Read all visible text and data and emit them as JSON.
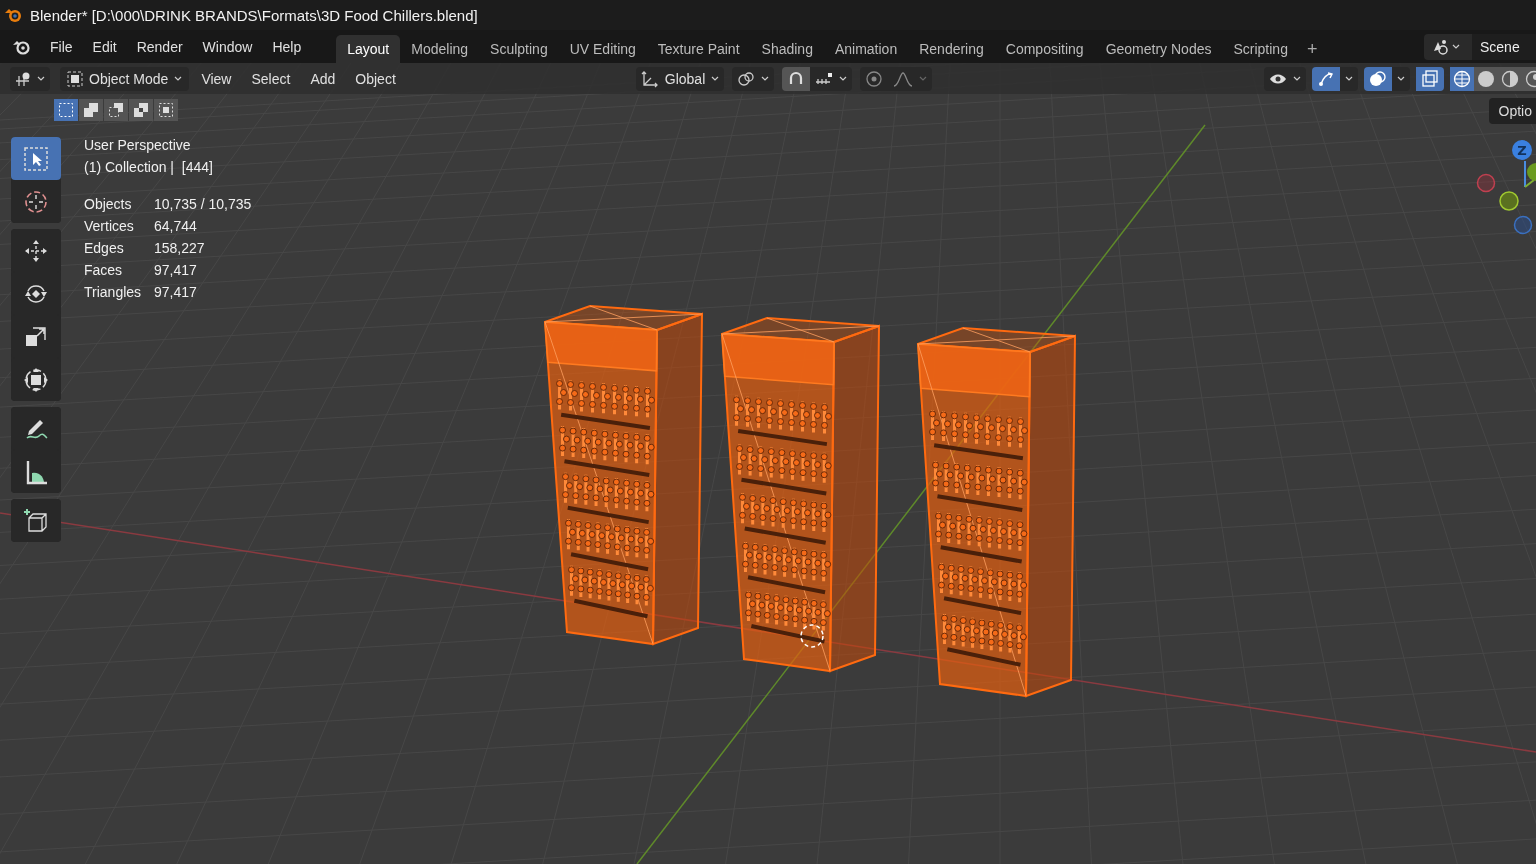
{
  "window": {
    "title": "Blender* [D:\\000\\DRINK BRANDS\\Formats\\3D Food Chillers.blend]"
  },
  "menu": [
    "File",
    "Edit",
    "Render",
    "Window",
    "Help"
  ],
  "workspaces": [
    {
      "label": "Layout",
      "selected": true
    },
    {
      "label": "Modeling",
      "selected": false
    },
    {
      "label": "Sculpting",
      "selected": false
    },
    {
      "label": "UV Editing",
      "selected": false
    },
    {
      "label": "Texture Paint",
      "selected": false
    },
    {
      "label": "Shading",
      "selected": false
    },
    {
      "label": "Animation",
      "selected": false
    },
    {
      "label": "Rendering",
      "selected": false
    },
    {
      "label": "Compositing",
      "selected": false
    },
    {
      "label": "Geometry Nodes",
      "selected": false
    },
    {
      "label": "Scripting",
      "selected": false
    }
  ],
  "add_workspace": "+",
  "scene": "Scene",
  "header": {
    "mode": "Object Mode",
    "menus": [
      "View",
      "Select",
      "Add",
      "Object"
    ],
    "orientation": "Global",
    "options": "Optio"
  },
  "select_modes": [
    {
      "kind": "set",
      "selected": true
    },
    {
      "kind": "extend",
      "selected": false
    },
    {
      "kind": "subtract",
      "selected": false
    },
    {
      "kind": "difference",
      "selected": false
    },
    {
      "kind": "intersect",
      "selected": false
    }
  ],
  "toggles": [
    {
      "kind": "gizmo",
      "on": true
    },
    {
      "kind": "overlay",
      "on": true
    },
    {
      "kind": "xray",
      "on": true
    }
  ],
  "shading": [
    {
      "kind": "wireframe",
      "selected": true
    },
    {
      "kind": "solid",
      "selected": false
    },
    {
      "kind": "material",
      "selected": false
    },
    {
      "kind": "rendered",
      "selected": false
    }
  ],
  "tools": [
    {
      "kind": "select-box",
      "selected": true
    },
    {
      "kind": "cursor",
      "selected": false
    },
    {
      "kind": "move",
      "selected": false
    },
    {
      "kind": "rotate",
      "selected": false
    },
    {
      "kind": "scale",
      "selected": false
    },
    {
      "kind": "transform",
      "selected": false
    },
    {
      "kind": "annotate",
      "selected": false
    },
    {
      "kind": "measure",
      "selected": false
    },
    {
      "kind": "add-cube",
      "selected": false
    }
  ],
  "overlay_info": {
    "view": "User Perspective",
    "collection": "(1) Collection |  [444]",
    "stats": [
      {
        "label": "Objects",
        "value": "10,735 / 10,735"
      },
      {
        "label": "Vertices",
        "value": "64,744"
      },
      {
        "label": "Edges",
        "value": "158,227"
      },
      {
        "label": "Faces",
        "value": "97,417"
      },
      {
        "label": "Triangles",
        "value": "97,417"
      }
    ]
  },
  "gizmo": {
    "z_label": "Z"
  }
}
